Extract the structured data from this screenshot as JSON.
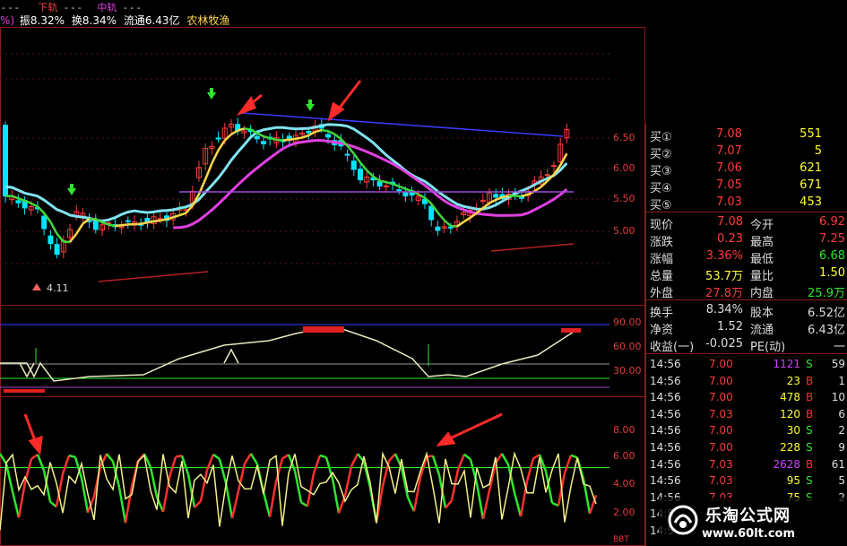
{
  "header": {
    "lead": "- - -",
    "lower_track_label": "下轨",
    "mid_track_label": "中轨",
    "dashes": "- - -"
  },
  "info": {
    "pct_stub": "%)",
    "amplitude": "振8.32%",
    "turnover": "换8.34%",
    "float_cap": "流通6.43亿",
    "stock_name": "农林牧渔"
  },
  "price_axis": [
    "6.50",
    "6.00",
    "5.50",
    "5.00"
  ],
  "low_marker": "4.11",
  "ind1_axis": [
    "90.00",
    "60.00",
    "30.00"
  ],
  "ind2_axis": [
    "8.00",
    "6.00",
    "4.00",
    "2.00"
  ],
  "ind2_cut": "BBT",
  "quote": {
    "book": [
      {
        "label": "买①",
        "price": "7.08",
        "vol": "551"
      },
      {
        "label": "买②",
        "price": "7.07",
        "vol": "5"
      },
      {
        "label": "买③",
        "price": "7.06",
        "vol": "621"
      },
      {
        "label": "买④",
        "price": "7.05",
        "vol": "671"
      },
      {
        "label": "买⑤",
        "price": "7.03",
        "vol": "453"
      }
    ],
    "stats": [
      {
        "l1": "现价",
        "v1": "7.08",
        "l2": "今开",
        "v2": "6.92"
      },
      {
        "l1": "涨跌",
        "v1": "0.23",
        "l2": "最高",
        "v2": "7.25"
      },
      {
        "l1": "涨幅",
        "v1": "3.36%",
        "l2": "最低",
        "v2": "6.68"
      },
      {
        "l1": "总量",
        "v1": "53.7万",
        "l2": "量比",
        "v2": "1.50"
      },
      {
        "l1": "外盘",
        "v1": "27.8万",
        "l2": "内盘",
        "v2": "25.9万"
      }
    ],
    "fund": [
      {
        "l1": "换手",
        "v1": "8.34%",
        "l2": "股本",
        "v2": "6.52亿"
      },
      {
        "l1": "净资",
        "v1": "1.52",
        "l2": "流通",
        "v2": "6.43亿"
      },
      {
        "l1": "收益(一)",
        "v1": "-0.025",
        "l2": "PE(动)",
        "v2": "一"
      }
    ]
  },
  "ticks": [
    {
      "time": "14:56",
      "price": "7.00",
      "vol": "1121",
      "side": "S",
      "n": "59"
    },
    {
      "time": "14:56",
      "price": "7.00",
      "vol": "23",
      "side": "B",
      "n": "1"
    },
    {
      "time": "14:56",
      "price": "7.00",
      "vol": "478",
      "side": "B",
      "n": "10"
    },
    {
      "time": "14:56",
      "price": "7.03",
      "vol": "120",
      "side": "B",
      "n": "6"
    },
    {
      "time": "14:56",
      "price": "7.00",
      "vol": "30",
      "side": "S",
      "n": "2"
    },
    {
      "time": "14:56",
      "price": "7.00",
      "vol": "228",
      "side": "S",
      "n": "9"
    },
    {
      "time": "14:56",
      "price": "7.03",
      "vol": "2628",
      "side": "B",
      "n": "61"
    },
    {
      "time": "14:56",
      "price": "7.03",
      "vol": "95",
      "side": "S",
      "n": "5"
    },
    {
      "time": "14:56",
      "price": "7.03",
      "vol": "75",
      "side": "S",
      "n": "2"
    },
    {
      "time": "14:5",
      "price": "",
      "vol": "",
      "side": "",
      "n": ""
    },
    {
      "time": "14:5",
      "price": "",
      "vol": "",
      "side": "",
      "n": ""
    }
  ],
  "watermark": {
    "title": "乐淘公式网",
    "url": "www.60lt.com"
  },
  "colors": {
    "up": "#ff3b3b",
    "down": "#00e5ff",
    "cyan_line": "#7fe3f0",
    "magenta_line": "#e040e0",
    "yellow_line": "#ffd84a",
    "green_line": "#3fd83f",
    "buy": "#ff2d2d",
    "sell": "#2ee62e",
    "big_vol": "#d040ff",
    "vol": "#ffff33"
  }
}
